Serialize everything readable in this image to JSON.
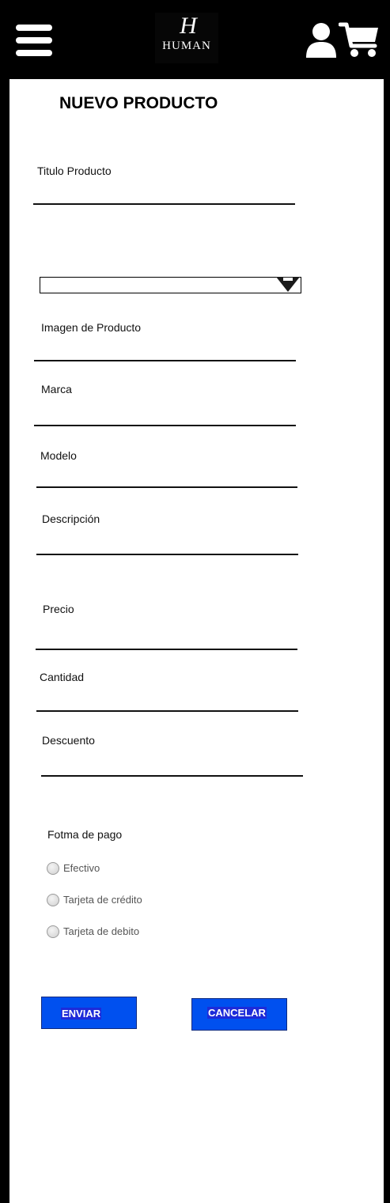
{
  "header": {
    "logo_mark": "H",
    "logo_text": "HUMAN",
    "icons": [
      "menu-icon",
      "user-icon",
      "cart-icon"
    ]
  },
  "page": {
    "title": "NUEVO PRODUCTO"
  },
  "form": {
    "titulo_label": "Titulo Producto",
    "category_value": "",
    "imagen_label": "Imagen de Producto",
    "marca_label": "Marca",
    "modelo_label": "Modelo",
    "descripcion_label": "Descripción",
    "precio_label": "Precio",
    "cantidad_label": "Cantidad",
    "descuento_label": "Descuento"
  },
  "payment": {
    "label": "Fotma de pago",
    "options": [
      "Efectivo",
      "Tarjeta de crédito",
      "Tarjeta de debito"
    ]
  },
  "buttons": {
    "submit": "ENVIAR",
    "cancel": "CANCELAR"
  },
  "colors": {
    "header_bg": "#000000",
    "button_bg": "#0050ef"
  }
}
